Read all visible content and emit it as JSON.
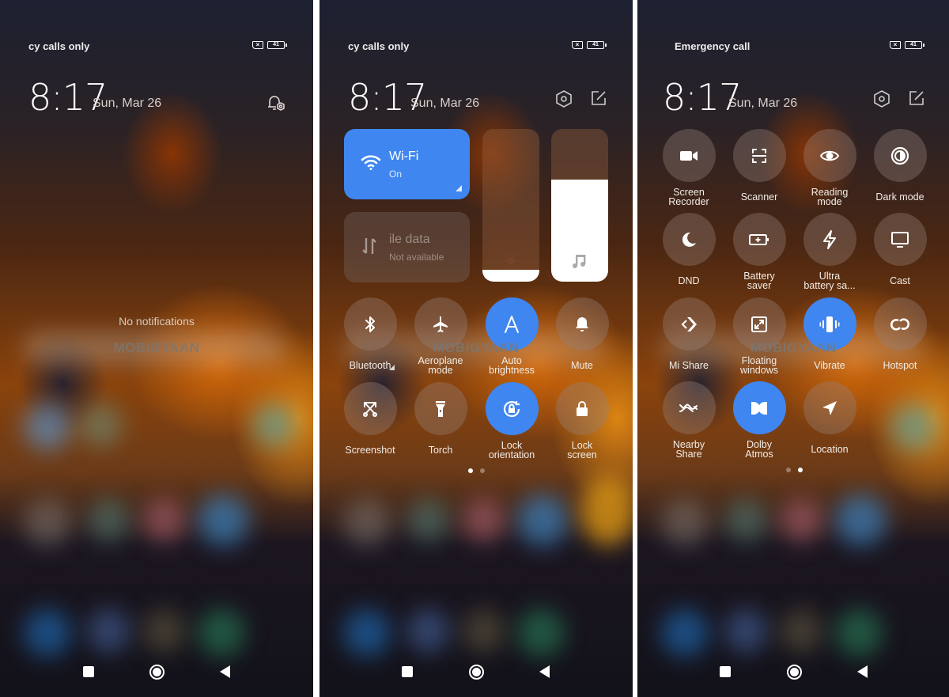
{
  "screens": [
    {
      "status": {
        "carrier_text": "cy calls only",
        "battery": "41"
      },
      "clock": "8:17",
      "date": "Sun, Mar 26",
      "notifications_empty": "No notifications",
      "watermark": "MOBIGYAAN"
    },
    {
      "status": {
        "carrier_text": "cy calls only",
        "battery": "41"
      },
      "clock": "8:17",
      "date": "Sun, Mar 26",
      "watermark": "MOBIGYAAN",
      "wifi": {
        "title": "Wi-Fi",
        "status": "On",
        "icon": "wifi-icon",
        "active": true
      },
      "mobile_data": {
        "title": "ile data",
        "status": "Not available",
        "icon": "mobile-data-icon",
        "active": false
      },
      "brightness": {
        "icon": "sun-icon",
        "level_percent": 8
      },
      "volume": {
        "icon": "music-note-icon",
        "level_percent": 67
      },
      "toggles": [
        {
          "label": "Bluetooth",
          "icon": "bluetooth-icon",
          "active": false,
          "has_menu": true
        },
        {
          "label": "Aeroplane\nmode",
          "icon": "airplane-icon",
          "active": false
        },
        {
          "label": "Auto\nbrightness",
          "icon": "auto-brightness-icon",
          "active": true
        },
        {
          "label": "Mute",
          "icon": "bell-icon",
          "active": false
        },
        {
          "label": "Screenshot",
          "icon": "screenshot-icon",
          "active": false
        },
        {
          "label": "Torch",
          "icon": "torch-icon",
          "active": false
        },
        {
          "label": "Lock\norientation",
          "icon": "lock-rotation-icon",
          "active": true
        },
        {
          "label": "Lock\nscreen",
          "icon": "lock-icon",
          "active": false
        }
      ],
      "page_indicator": {
        "pages": 2,
        "current": 1
      }
    },
    {
      "status": {
        "carrier_text": "Emergency call",
        "battery": "41"
      },
      "clock": "8:17",
      "date": "Sun, Mar 26",
      "watermark": "MOBIGYAAN",
      "toggles": [
        {
          "label": "Screen\nRecorder",
          "icon": "video-camera-icon",
          "active": false
        },
        {
          "label": "Scanner",
          "icon": "scanner-icon",
          "active": false
        },
        {
          "label": "Reading\nmode",
          "icon": "eye-icon",
          "active": false
        },
        {
          "label": "Dark mode",
          "icon": "dark-mode-icon",
          "active": false
        },
        {
          "label": "DND",
          "icon": "moon-icon",
          "active": false
        },
        {
          "label": "Battery\nsaver",
          "icon": "battery-plus-icon",
          "active": false
        },
        {
          "label": "Ultra\nbattery sa...",
          "icon": "lightning-icon",
          "active": false
        },
        {
          "label": "Cast",
          "icon": "monitor-icon",
          "active": false
        },
        {
          "label": "Mi Share",
          "icon": "mi-share-icon",
          "active": false
        },
        {
          "label": "Floating\nwindows",
          "icon": "floating-window-icon",
          "active": false
        },
        {
          "label": "Vibrate",
          "icon": "vibrate-icon",
          "active": true
        },
        {
          "label": "Hotspot",
          "icon": "hotspot-icon",
          "active": false
        },
        {
          "label": "Nearby\nShare",
          "icon": "nearby-share-icon",
          "active": false
        },
        {
          "label": "Dolby\nAtmos",
          "icon": "dolby-icon",
          "active": true
        },
        {
          "label": "Location",
          "icon": "location-arrow-icon",
          "active": false
        }
      ],
      "page_indicator": {
        "pages": 2,
        "current": 2
      }
    }
  ],
  "colors": {
    "accent": "#3f86f0",
    "tile_inactive": "rgba(150,130,120,0.38)"
  },
  "navbar": {
    "recents": "square-icon",
    "home": "circle-icon",
    "back": "triangle-back-icon"
  }
}
